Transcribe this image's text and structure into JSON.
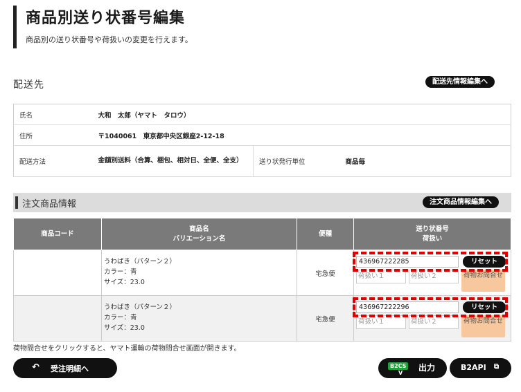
{
  "page": {
    "title": "商品別送り状番号編集",
    "description": "商品別の送り状番号や荷扱いの変更を行えます。"
  },
  "delivery": {
    "section_title": "配送先",
    "edit_button": "配送先情報編集へ",
    "rows": {
      "name_label": "氏名",
      "name_value": "大和　太郎（ヤマト　タロウ）",
      "address_label": "住所",
      "address_value": "〒1040061　東京都中央区銀座2-12-18",
      "method_label": "配送方法",
      "method_value": "金額別送料（合算、梱包、相対日、全便、全支）",
      "unit_label": "送り状発行単位",
      "unit_value": "商品毎"
    }
  },
  "order": {
    "section_title": "注文商品情報",
    "edit_button": "注文商品情報編集へ",
    "columns": {
      "code": "商品コード",
      "name_line1": "商品名",
      "name_line2": "バリエーション名",
      "shipping": "便種",
      "tracking_line1": "送り状番号",
      "tracking_line2": "荷扱い"
    },
    "rows": [
      {
        "code": "",
        "name": "うわばき（パターン２）",
        "color": "カラー：青",
        "size": "サイズ：23.0",
        "shipping": "宅急便",
        "tracking": "436967222285",
        "reset": "リセット",
        "handling1_placeholder": "荷扱い１",
        "handling2_placeholder": "荷扱い２",
        "inquiry": "荷物お問合せ"
      },
      {
        "code": "",
        "name": "うわばき（パターン２）",
        "color": "カラー：青",
        "size": "サイズ：23.0",
        "shipping": "宅急便",
        "tracking": "436967222296",
        "reset": "リセット",
        "handling1_placeholder": "荷扱い１",
        "handling2_placeholder": "荷扱い２",
        "inquiry": "荷物お問合せ"
      }
    ]
  },
  "note": "荷物問合せをクリックすると、ヤマト運輸の荷物問合せ画面が開きます。",
  "footer": {
    "back_label": "受注明細へ",
    "b2cs_badge": "B2CS",
    "b2cs_sub": "V",
    "output_label": "出力",
    "api_label": "B2API"
  },
  "colors": {
    "highlight": "#e00000",
    "inquiry_bg": "#f7c79d",
    "badge_green": "#1fa03a"
  }
}
